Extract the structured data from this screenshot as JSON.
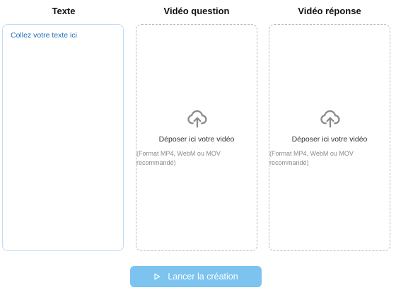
{
  "columns": {
    "text": {
      "title": "Texte",
      "placeholder": "Collez votre texte ici"
    },
    "video_question": {
      "title": "Vidéo question",
      "drop_label": "Déposer ici votre vidéo",
      "hint": "(Format MP4, WebM ou MOV recommandé)",
      "icon": "upload-cloud-icon"
    },
    "video_reponse": {
      "title": "Vidéo réponse",
      "drop_label": "Déposer ici votre vidéo",
      "hint": "(Format MP4, WebM ou MOV recommandé)",
      "icon": "upload-cloud-icon"
    }
  },
  "action": {
    "label": "Lancer la création",
    "icon": "play-icon",
    "color": "#7cc3ef"
  },
  "colors": {
    "text_border": "#bfdcf7",
    "placeholder": "#1d6fb8",
    "dashed_border": "#b9b9b9",
    "icon_gray": "#8a8a8a"
  }
}
